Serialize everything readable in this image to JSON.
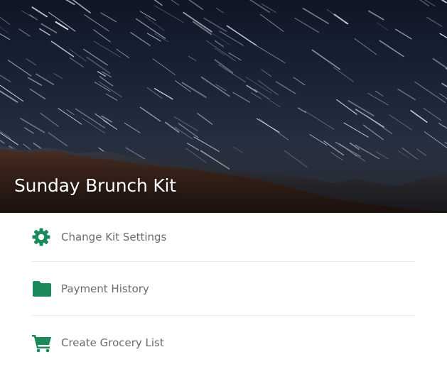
{
  "hero": {
    "title": "Sunday Brunch Kit"
  },
  "menu": {
    "items": [
      {
        "label": "Change Kit Settings",
        "icon": "gear-icon"
      },
      {
        "label": "Payment History",
        "icon": "folder-icon"
      },
      {
        "label": "Create Grocery List",
        "icon": "cart-icon"
      }
    ]
  },
  "colors": {
    "accent": "#1a8a5a",
    "label_text": "#6b6b6b",
    "divider": "#ececec"
  }
}
